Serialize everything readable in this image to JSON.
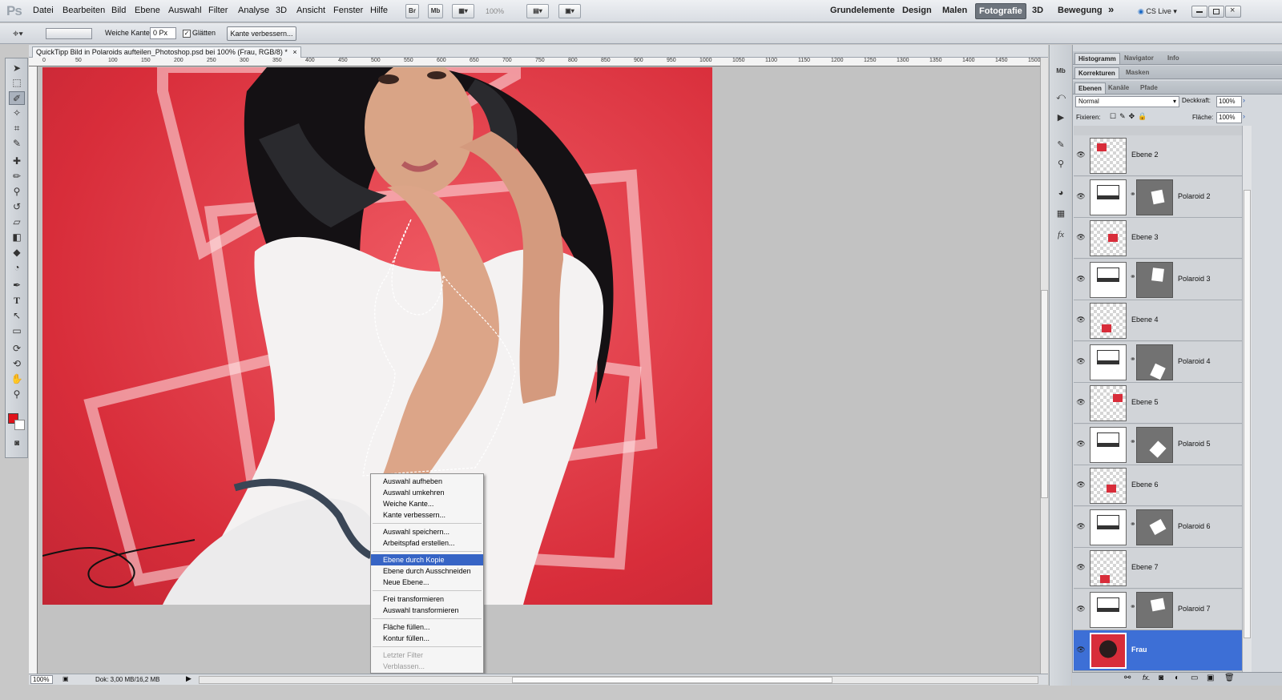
{
  "app": {
    "logo": "Ps"
  },
  "menu": [
    "Datei",
    "Bearbeiten",
    "Bild",
    "Ebene",
    "Auswahl",
    "Filter",
    "Analyse",
    "3D",
    "Ansicht",
    "Fenster",
    "Hilfe"
  ],
  "apptoolbar": {
    "br": "Br",
    "mb": "Mb",
    "zoom": "100%"
  },
  "workspaces": [
    "Grundelemente",
    "Design",
    "Malen",
    "Fotografie",
    "3D",
    "Bewegung"
  ],
  "workspace_active": "Fotografie",
  "more": "»",
  "cslive": "CS Live",
  "options": {
    "feather_label": "Weiche Kante:",
    "feather_value": "0 Px",
    "antialias_label": "Glätten",
    "refine_button": "Kante verbessern..."
  },
  "document": {
    "tab_title": "QuickTipp Bild in Polaroids aufteilen_Photoshop.psd bei 100% (Frau, RGB/8) *",
    "close": "×"
  },
  "ruler_h": [
    "0",
    "50",
    "100",
    "150",
    "200",
    "250",
    "300",
    "350",
    "400",
    "450",
    "500",
    "550",
    "600",
    "650",
    "700",
    "750",
    "800",
    "850",
    "900",
    "950",
    "1000",
    "1050",
    "1100",
    "1150",
    "1200",
    "1250",
    "1300",
    "1350",
    "1400",
    "1450",
    "1500"
  ],
  "status": {
    "zoom": "100%",
    "doc": "Dok: 3,00 MB/16,2 MB"
  },
  "context_menu": {
    "items": [
      {
        "label": "Auswahl aufheben",
        "state": "normal"
      },
      {
        "label": "Auswahl umkehren",
        "state": "normal"
      },
      {
        "label": "Weiche Kante...",
        "state": "normal"
      },
      {
        "label": "Kante verbessern...",
        "state": "normal"
      },
      {
        "sep": true
      },
      {
        "label": "Auswahl speichern...",
        "state": "normal"
      },
      {
        "label": "Arbeitspfad erstellen...",
        "state": "normal"
      },
      {
        "sep": true
      },
      {
        "label": "Ebene durch Kopie",
        "state": "highlighted"
      },
      {
        "label": "Ebene durch Ausschneiden",
        "state": "normal"
      },
      {
        "label": "Neue Ebene...",
        "state": "normal"
      },
      {
        "sep": true
      },
      {
        "label": "Frei transformieren",
        "state": "normal"
      },
      {
        "label": "Auswahl transformieren",
        "state": "normal"
      },
      {
        "sep": true
      },
      {
        "label": "Fläche füllen...",
        "state": "normal"
      },
      {
        "label": "Kontur füllen...",
        "state": "normal"
      },
      {
        "sep": true
      },
      {
        "label": "Letzter Filter",
        "state": "disabled"
      },
      {
        "label": "Verblassen...",
        "state": "disabled"
      }
    ]
  },
  "panel": {
    "tabs1": [
      "Histogramm",
      "Navigator",
      "Info"
    ],
    "tabs2": [
      "Korrekturen",
      "Masken"
    ],
    "tabs3": [
      "Ebenen",
      "Kanäle",
      "Pfade"
    ],
    "blend_mode": "Normal",
    "opacity_label": "Deckkraft:",
    "opacity": "100%",
    "lock_label": "Fixieren:",
    "fill_label": "Fläche:",
    "fill": "100%"
  },
  "layers": [
    {
      "name": "Ebene 2",
      "kind": "pixel",
      "selected": false
    },
    {
      "name": "Polaroid 2",
      "kind": "mask",
      "selected": false
    },
    {
      "name": "Ebene 3",
      "kind": "pixel",
      "selected": false
    },
    {
      "name": "Polaroid 3",
      "kind": "mask",
      "selected": false
    },
    {
      "name": "Ebene 4",
      "kind": "pixel",
      "selected": false
    },
    {
      "name": "Polaroid 4",
      "kind": "mask",
      "selected": false
    },
    {
      "name": "Ebene 5",
      "kind": "pixel",
      "selected": false
    },
    {
      "name": "Polaroid 5",
      "kind": "mask",
      "selected": false
    },
    {
      "name": "Ebene 6",
      "kind": "pixel",
      "selected": false
    },
    {
      "name": "Polaroid 6",
      "kind": "mask",
      "selected": false
    },
    {
      "name": "Ebene 7",
      "kind": "pixel",
      "selected": false
    },
    {
      "name": "Polaroid 7",
      "kind": "mask",
      "selected": false
    },
    {
      "name": "Frau",
      "kind": "photo",
      "selected": true
    }
  ],
  "colors": {
    "foreground": "#e0121b",
    "background": "#ffffff",
    "accent": "#3664c5",
    "photo_bg": "#d82d3a"
  }
}
